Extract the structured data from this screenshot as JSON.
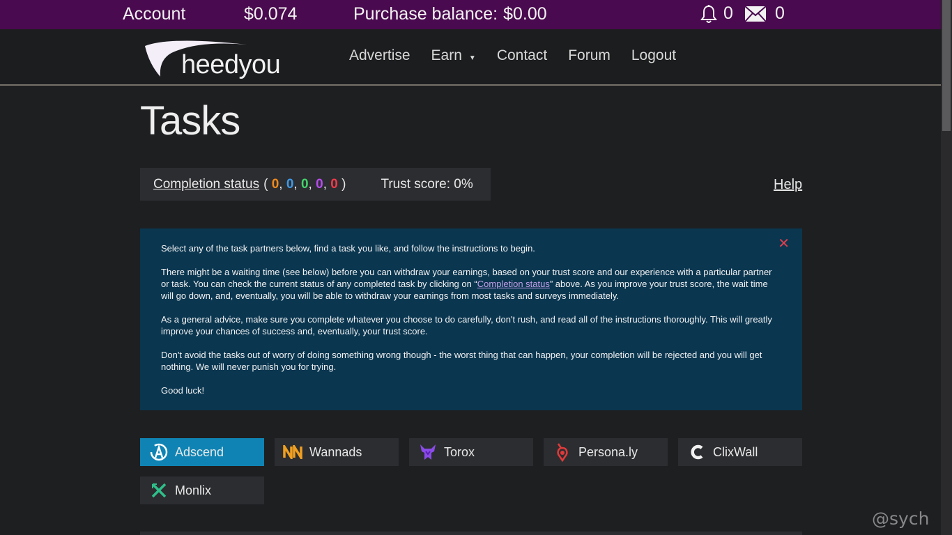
{
  "topbar": {
    "account_label": "Account",
    "earnings": "$0.074",
    "purchase_label": "Purchase balance:",
    "purchase_value": "$0.00",
    "notifications_count": "0",
    "messages_count": "0"
  },
  "nav": {
    "logo_text": "heedyou",
    "items": [
      {
        "label": "Advertise"
      },
      {
        "label": "Earn"
      },
      {
        "label": "Contact"
      },
      {
        "label": "Forum"
      },
      {
        "label": "Logout"
      }
    ]
  },
  "page": {
    "title": "Tasks"
  },
  "status": {
    "link_label": "Completion status",
    "counts": [
      {
        "value": "0",
        "color": "#f08a1c"
      },
      {
        "value": "0",
        "color": "#3f9ae8"
      },
      {
        "value": "0",
        "color": "#41d36a"
      },
      {
        "value": "0",
        "color": "#b84cf0"
      },
      {
        "value": "0",
        "color": "#f03a4c"
      }
    ],
    "trust_label": "Trust score: 0%",
    "help_label": "Help"
  },
  "info": {
    "p1": "Select any of the task partners below, find a task you like, and follow the instructions to begin.",
    "p2_a": "There might be a waiting time (see below) before you can withdraw your earnings, based on your trust score and our experience with a particular partner or task. You can check the current status of any completed task by clicking on “",
    "p2_link": "Completion status",
    "p2_b": "” above. As you improve your trust score, the wait time will go down, and, eventually, you will be able to withdraw your earnings from most tasks and surveys immediately.",
    "p3": "As a general advice, make sure you complete whatever you choose to do carefully, don't rush, and read all of the instructions thoroughly. This will greatly improve your chances of success and, eventually, your trust score.",
    "p4": "Don't avoid the tasks out of worry of doing something wrong though - the worst thing that can happen, your completion will be rejected and you will get nothing. We will never punish you for trying.",
    "p5": "Good luck!"
  },
  "partners": [
    {
      "label": "Adscend",
      "icon": "adscend-icon",
      "active": true
    },
    {
      "label": "Wannads",
      "icon": "wannads-icon",
      "active": false
    },
    {
      "label": "Torox",
      "icon": "torox-icon",
      "active": false
    },
    {
      "label": "Persona.ly",
      "icon": "personaly-icon",
      "active": false
    },
    {
      "label": "ClixWall",
      "icon": "clixwall-icon",
      "active": false
    },
    {
      "label": "Monlix",
      "icon": "monlix-icon",
      "active": false
    }
  ],
  "watermark": "@sych"
}
